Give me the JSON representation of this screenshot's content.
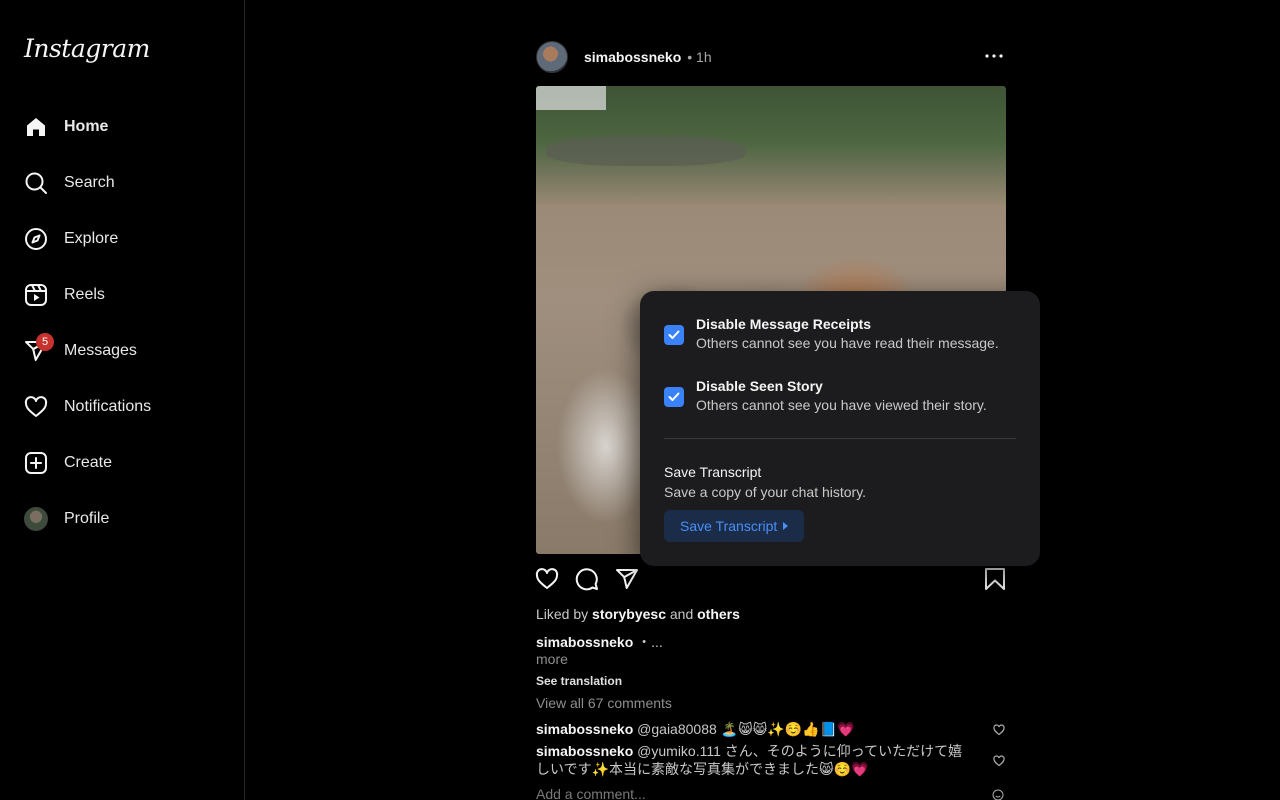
{
  "app": {
    "logo_text": "Instagram"
  },
  "sidebar": {
    "items": [
      {
        "label": "Home",
        "icon": "home-icon",
        "active": true
      },
      {
        "label": "Search",
        "icon": "search-icon"
      },
      {
        "label": "Explore",
        "icon": "compass-icon"
      },
      {
        "label": "Reels",
        "icon": "reels-icon"
      },
      {
        "label": "Messages",
        "icon": "send-icon",
        "badge": "5"
      },
      {
        "label": "Notifications",
        "icon": "heart-icon"
      },
      {
        "label": "Create",
        "icon": "plus-square-icon"
      },
      {
        "label": "Profile",
        "icon": "avatar"
      }
    ],
    "badge_color": "#c8322e"
  },
  "post": {
    "username": "simabossneko",
    "time": "• 1h",
    "liked_by_prefix": "Liked by",
    "liked_by_user": "storybyesc",
    "liked_and": "and",
    "liked_others": "others",
    "caption_user": "simabossneko",
    "caption_text": " ・...",
    "more": "more",
    "see_translation": "See translation",
    "view_all": "View all 67 comments",
    "comments": [
      {
        "user": "simabossneko",
        "text": " @gaia80088 🏝️😸😸✨☺️👍📘💗"
      },
      {
        "user": "simabossneko",
        "text": " @yumiko.111 さん、そのように仰っていただけて嬉しいです✨本当に素敵な写真集ができました😸☺️💗"
      }
    ],
    "add_comment_placeholder": "Add a comment..."
  },
  "popup": {
    "option1_title": "Disable Message Receipts",
    "option1_desc": "Others cannot see you have read their message.",
    "option1_checked": true,
    "option2_title": "Disable Seen Story",
    "option2_desc": "Others cannot see you have viewed their story.",
    "option2_checked": true,
    "save_title": "Save Transcript",
    "save_desc": "Save a copy of your chat history.",
    "save_button": "Save Transcript",
    "accent": "#3a82f7"
  }
}
